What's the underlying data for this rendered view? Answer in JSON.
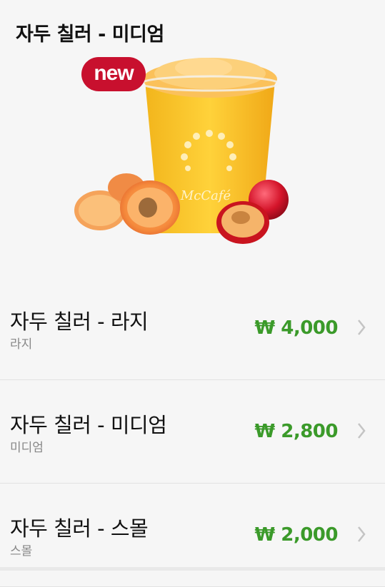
{
  "header": {
    "title": "자두 칠러 - 미디엄",
    "badge_label": "new",
    "product_image": {
      "cup_logo": "McCafé",
      "icon": "plum-chiller-drink-image"
    }
  },
  "menu": {
    "items": [
      {
        "name": "자두 칠러 - 라지",
        "size": "라지",
        "price": "₩ 4,000"
      },
      {
        "name": "자두 칠러 - 미디엄",
        "size": "미디엄",
        "price": "₩ 2,800"
      },
      {
        "name": "자두 칠러 - 스몰",
        "size": "스몰",
        "price": "₩ 2,000"
      }
    ],
    "chevron_icon": "chevron-right-icon"
  },
  "colors": {
    "price": "#3b9a2a",
    "badge": "#c8102e",
    "background": "#f6f6f6"
  }
}
